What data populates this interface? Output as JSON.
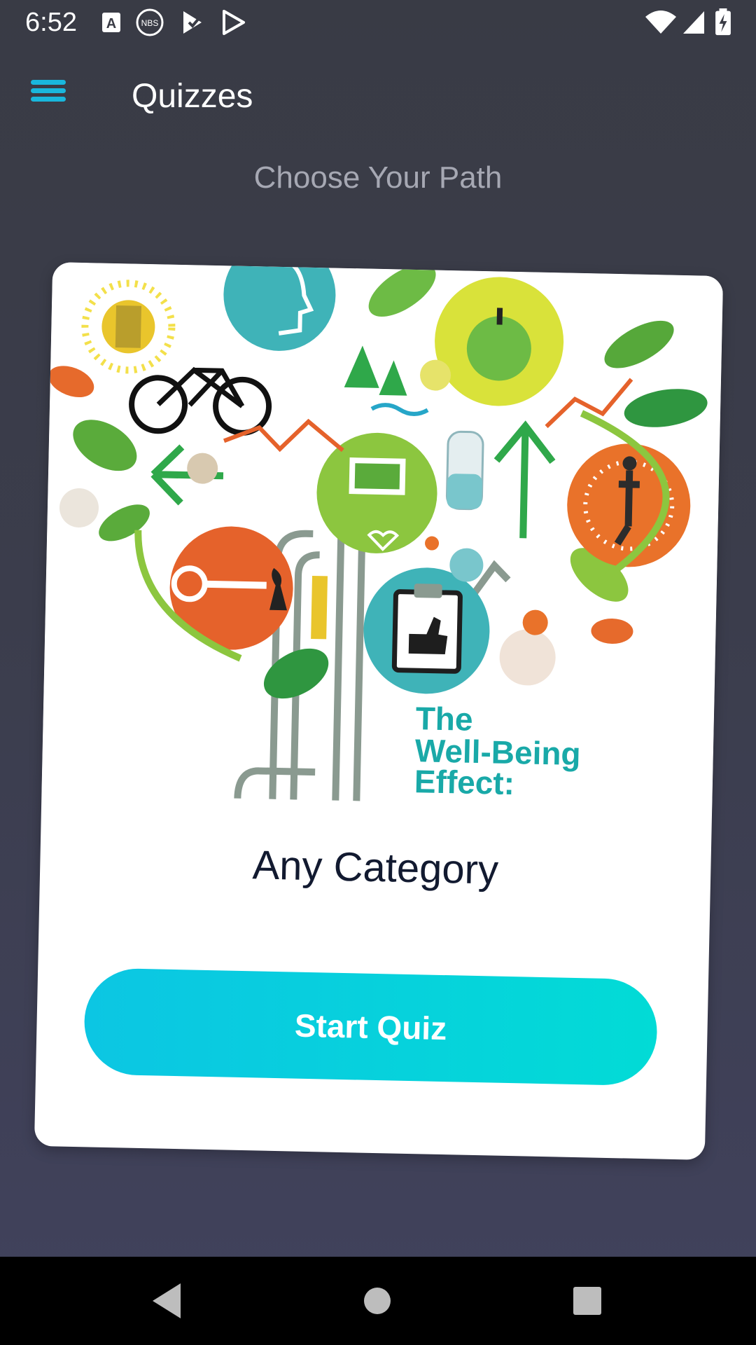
{
  "status_bar": {
    "time": "6:52",
    "left_icons": [
      "a-notification-icon",
      "nbs-app-icon",
      "play-store-check-icon",
      "play-store-icon"
    ],
    "right_icons": [
      "wifi-icon",
      "signal-icon",
      "battery-charging-icon"
    ]
  },
  "app_bar": {
    "menu_icon": "hamburger-menu-icon",
    "title": "Quizzes",
    "accent_color": "#19b7dd"
  },
  "subtitle": "Choose Your Path",
  "card": {
    "illustration": {
      "description_icon": "well-being-tree-illustration",
      "text_line_1": "The",
      "text_line_2": "Well-Being",
      "text_line_3": "Effect:"
    },
    "category": "Any Category",
    "start_button_label": "Start Quiz",
    "button_gradient": [
      "#0cc6e3",
      "#02dbd6"
    ]
  },
  "nav_bar": {
    "back_icon": "back-triangle-icon",
    "home_icon": "home-circle-icon",
    "recents_icon": "recents-square-icon"
  }
}
